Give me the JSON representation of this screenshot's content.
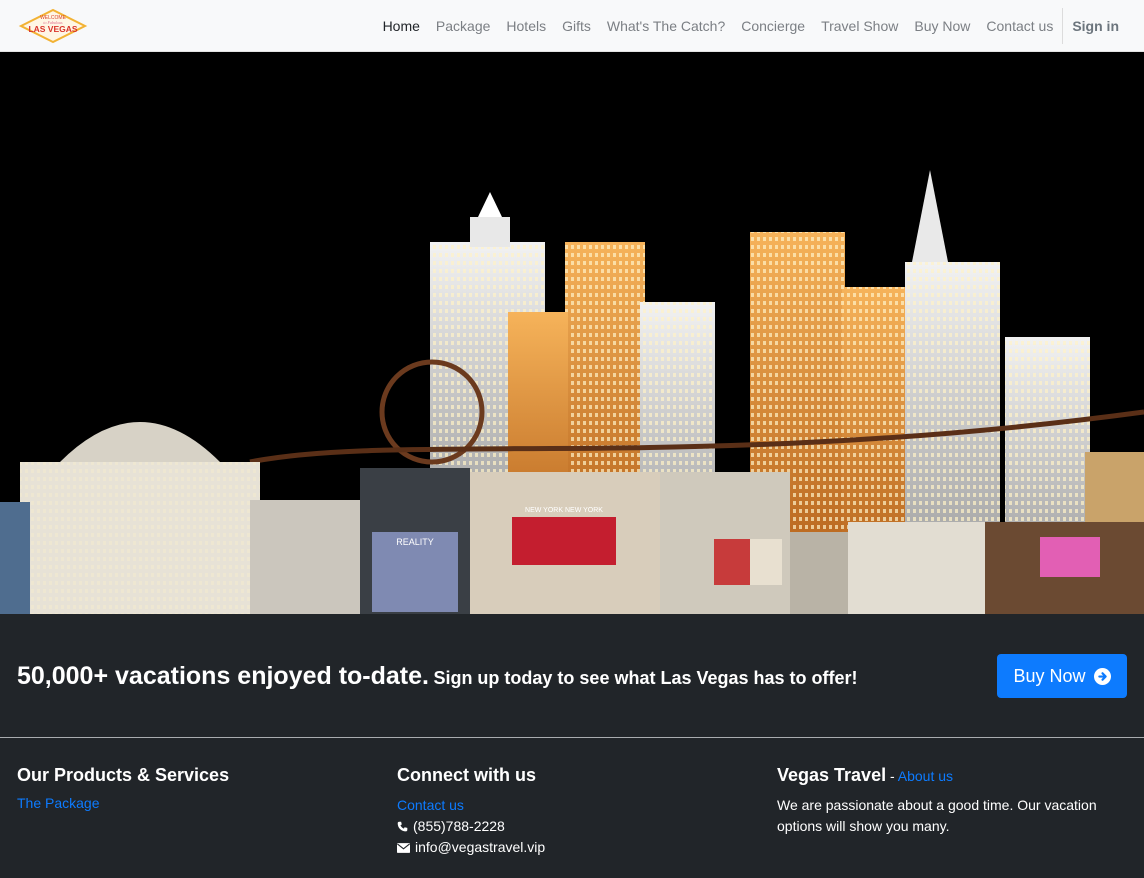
{
  "brand": {
    "logo_top": "WELCOME",
    "logo_mid": "to Fabulous",
    "logo_main": "LAS VEGAS"
  },
  "nav": {
    "items": [
      {
        "label": "Home",
        "active": true
      },
      {
        "label": "Package"
      },
      {
        "label": "Hotels"
      },
      {
        "label": "Gifts"
      },
      {
        "label": "What's The Catch?"
      },
      {
        "label": "Concierge"
      },
      {
        "label": "Travel Show"
      },
      {
        "label": "Buy Now"
      },
      {
        "label": "Contact us"
      }
    ],
    "signin": "Sign in"
  },
  "hero": {
    "sign1": "REALITY",
    "sign2": "NEW YORK NEW YORK"
  },
  "cta": {
    "headline": "50,000+ vacations enjoyed to-date.",
    "subline": "Sign up today to see what Las Vegas has to offer!",
    "button": "Buy Now",
    "button_icon": "arrow-circle-right-icon"
  },
  "footer": {
    "products": {
      "title": "Our Products & Services",
      "link": "The Package"
    },
    "connect": {
      "title": "Connect with us",
      "link": "Contact us",
      "phone": "(855)788-2228",
      "email": "info@vegastravel.vip"
    },
    "about": {
      "title": "Vegas Travel",
      "dash": " - ",
      "link": "About us",
      "text": "We are passionate about a good time. Our vacation options will show you many."
    }
  },
  "colors": {
    "accent": "#0d7bfe",
    "dark": "#212529",
    "navbg": "#f8f9fa"
  }
}
